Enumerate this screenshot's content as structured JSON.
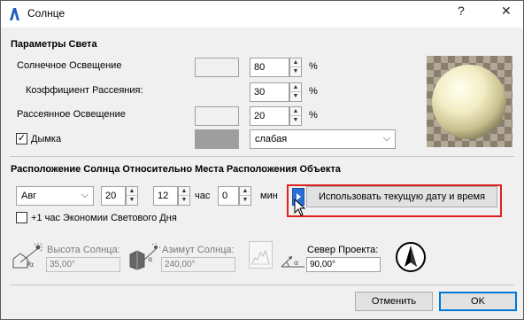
{
  "window": {
    "title": "Солнце",
    "help_label": "?",
    "close_label": "✕"
  },
  "light": {
    "section_title": "Параметры Света",
    "sunlight_label": "Солнечное Освещение",
    "sunlight_value": "80",
    "sunlight_unit": "%",
    "scatter_label": "Коэффициент Рассеяния:",
    "scatter_value": "30",
    "scatter_unit": "%",
    "ambient_label": "Рассеянное Освещение",
    "ambient_value": "20",
    "ambient_unit": "%",
    "haze_label": "Дымка",
    "haze_checked": true,
    "haze_level": "слабая",
    "sunlight_color": "#ffffff",
    "ambient_color": "#ffffff",
    "haze_color": "#9e9e9e"
  },
  "position": {
    "section_title": "Расположение Солнца Относительно Места Расположения Объекта",
    "month": "Авг",
    "day": "20",
    "hour": "12",
    "hour_unit": "час",
    "minute": "0",
    "minute_unit": "мин",
    "use_current_button": "Использовать текущую дату и время",
    "dst_label": "+1 час Экономии Светового Дня",
    "dst_checked": false,
    "altitude_label": "Высота Солнца:",
    "altitude_value": "35,00°",
    "azimuth_label": "Азимут Солнца:",
    "azimuth_value": "240,00°",
    "north_label": "Север Проекта:",
    "north_value": "90,00°"
  },
  "footer": {
    "cancel_label": "Отменить",
    "ok_label": "OK"
  },
  "colors": {
    "highlight_box": "#e02020",
    "default_button_border": "#0078d7"
  }
}
